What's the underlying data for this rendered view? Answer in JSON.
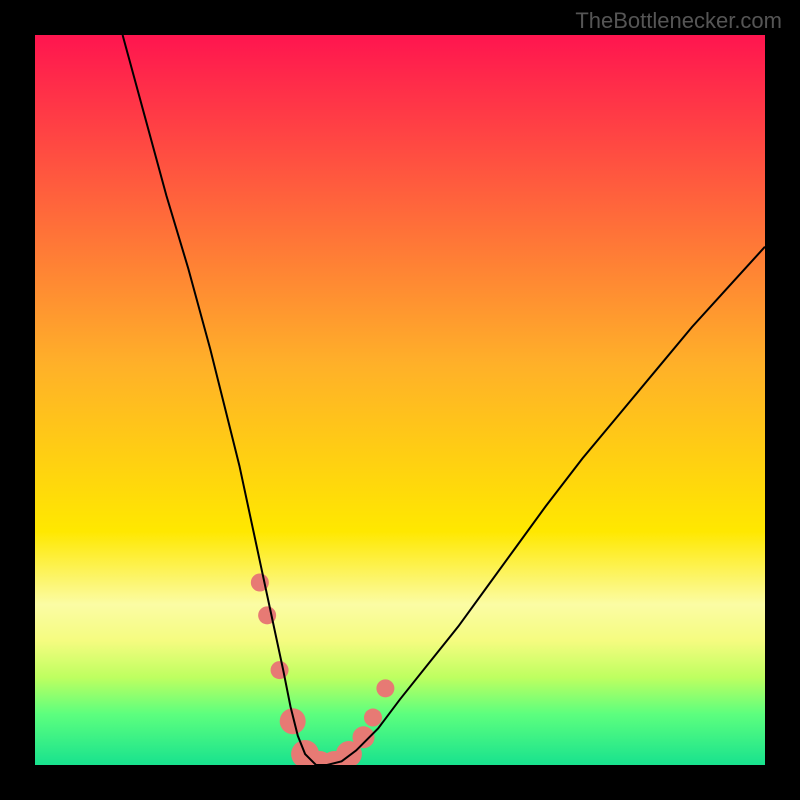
{
  "watermark": "TheBottlenecker.com",
  "chart_data": {
    "type": "line",
    "title": "",
    "xlabel": "",
    "ylabel": "",
    "xlim": [
      0,
      100
    ],
    "ylim": [
      0,
      100
    ],
    "background_gradient": {
      "stops": [
        {
          "offset": 0.0,
          "color": "#ff154f"
        },
        {
          "offset": 0.45,
          "color": "#ffb029"
        },
        {
          "offset": 0.68,
          "color": "#ffe800"
        },
        {
          "offset": 0.78,
          "color": "#fbfca4"
        },
        {
          "offset": 0.83,
          "color": "#f5fc80"
        },
        {
          "offset": 0.88,
          "color": "#beff60"
        },
        {
          "offset": 0.93,
          "color": "#5dff7e"
        },
        {
          "offset": 1.0,
          "color": "#18e28e"
        }
      ]
    },
    "series": [
      {
        "name": "curve",
        "x": [
          12,
          15,
          18,
          21,
          24,
          26,
          28,
          29.5,
          31,
          32.5,
          34,
          35,
          36,
          37,
          38.5,
          40,
          42,
          44,
          47,
          50,
          54,
          58,
          62,
          66,
          70,
          75,
          80,
          85,
          90,
          95,
          100
        ],
        "y": [
          100,
          89,
          78,
          68,
          57,
          49,
          41,
          34,
          27,
          20,
          13,
          8,
          4,
          1.5,
          0,
          0,
          0.5,
          2,
          5,
          9,
          14,
          19,
          24.5,
          30,
          35.5,
          42,
          48,
          54,
          60,
          65.5,
          71
        ],
        "stroke": "#000000",
        "stroke_width": 2
      }
    ],
    "markers": [
      {
        "x": 30.8,
        "y": 25.0,
        "r": 9,
        "fill": "#e77a74"
      },
      {
        "x": 31.8,
        "y": 20.5,
        "r": 9,
        "fill": "#e77a74"
      },
      {
        "x": 33.5,
        "y": 13.0,
        "r": 9,
        "fill": "#e77a74"
      },
      {
        "x": 35.3,
        "y": 6.0,
        "r": 13,
        "fill": "#e77a74"
      },
      {
        "x": 37.0,
        "y": 1.5,
        "r": 14,
        "fill": "#e77a74"
      },
      {
        "x": 39.0,
        "y": 0.0,
        "r": 14,
        "fill": "#e77a74"
      },
      {
        "x": 41.0,
        "y": 0.0,
        "r": 14,
        "fill": "#e77a74"
      },
      {
        "x": 43.0,
        "y": 1.5,
        "r": 13,
        "fill": "#e77a74"
      },
      {
        "x": 45.0,
        "y": 3.8,
        "r": 11,
        "fill": "#e77a74"
      },
      {
        "x": 46.3,
        "y": 6.5,
        "r": 9,
        "fill": "#e77a74"
      },
      {
        "x": 48.0,
        "y": 10.5,
        "r": 9,
        "fill": "#e77a74"
      }
    ]
  }
}
